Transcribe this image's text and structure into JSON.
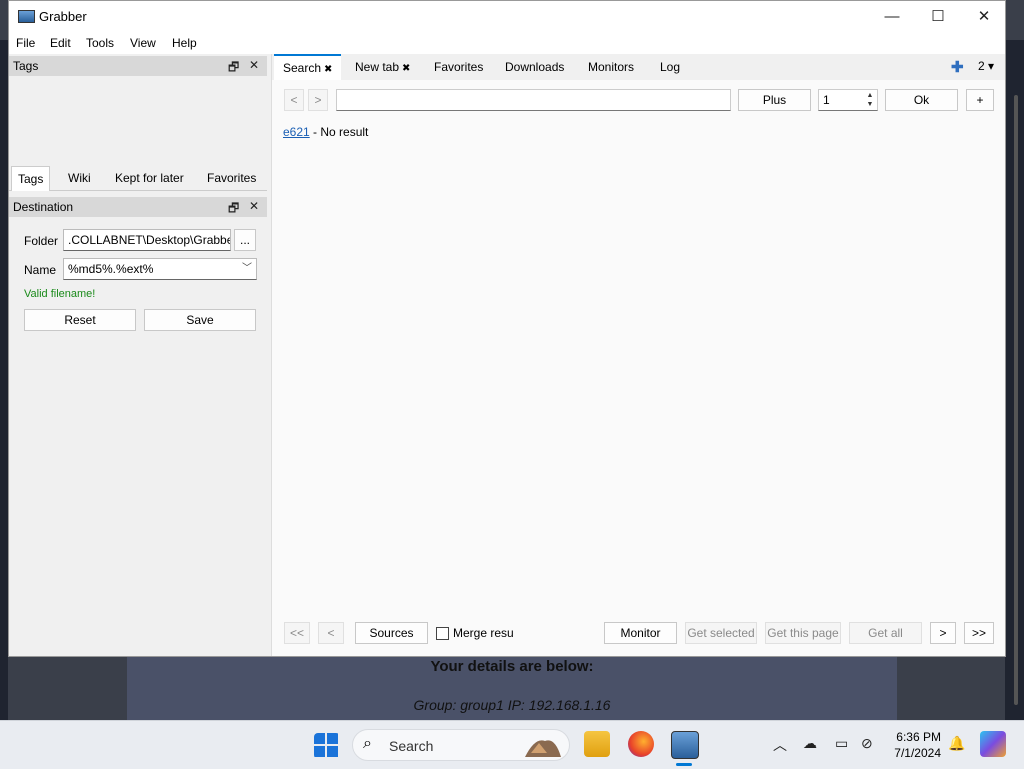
{
  "window": {
    "title": "Grabber",
    "controls": {
      "minimize": "—",
      "maximize": "☐",
      "close": "✕"
    }
  },
  "menu": [
    "File",
    "Edit",
    "Tools",
    "View",
    "Help"
  ],
  "tags_dock": {
    "title": "Tags",
    "float_icon": "🗗",
    "close_icon": "✕",
    "tabs": [
      "Tags",
      "Wiki",
      "Kept for later",
      "Favorites"
    ]
  },
  "destination_dock": {
    "title": "Destination",
    "float_icon": "🗗",
    "close_icon": "✕",
    "folder_label": "Folder",
    "folder_value": ".COLLABNET\\Desktop\\Grabber",
    "browse_label": "...",
    "name_label": "Name",
    "name_value": "%md5%.%ext%",
    "validation": "Valid filename!",
    "reset_label": "Reset",
    "save_label": "Save"
  },
  "main_tabs": [
    {
      "label": "Search",
      "closable": true
    },
    {
      "label": "New tab",
      "closable": true
    },
    {
      "label": "Favorites",
      "closable": false
    },
    {
      "label": "Downloads",
      "closable": false
    },
    {
      "label": "Monitors",
      "closable": false
    },
    {
      "label": "Log",
      "closable": false
    }
  ],
  "tab_controls": {
    "add": "✚",
    "count": "2 ▾"
  },
  "search": {
    "back": "<",
    "forward": ">",
    "query": "",
    "plus_label": "Plus",
    "page_value": "1",
    "ok_label": "Ok",
    "add_label": "+"
  },
  "result": {
    "source": "e621",
    "message": " - No result"
  },
  "bottom_bar": {
    "first": "<<",
    "prev": "<",
    "sources_label": "Sources",
    "merge_label": "Merge resu",
    "monitor_label": "Monitor",
    "get_selected": "Get selected",
    "get_page": "Get this page",
    "get_all": "Get all",
    "next": ">",
    "last": ">>"
  },
  "background_page": {
    "heading": "Your details are below:",
    "details": "Group: group1   IP: 192.168.1.16"
  },
  "taskbar": {
    "search_label": "Search",
    "time": "6:36 PM",
    "date": "7/1/2024"
  },
  "colors": {
    "accent": "#0078d4",
    "link": "#1a5fb4",
    "valid": "#1a8a1a"
  }
}
